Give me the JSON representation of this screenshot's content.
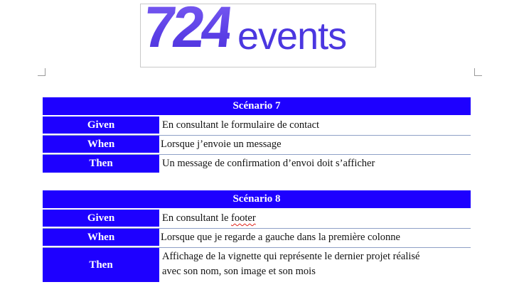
{
  "logo": {
    "number": "724",
    "word": "events"
  },
  "scenarios": [
    {
      "title": "Scénario 7",
      "rows": [
        {
          "label": "Given",
          "text": "En consultant le formulaire de contact"
        },
        {
          "label": "When",
          "text": "Lorsque j’envoie un message"
        },
        {
          "label": "Then",
          "text": "Un message de confirmation d’envoi doit s’afficher"
        }
      ]
    },
    {
      "title": "Scénario 8",
      "rows": [
        {
          "label": "Given",
          "text_before": "En consultant le ",
          "text_flagged": "footer"
        },
        {
          "label": "When",
          "text": "Lorsque que je regarde a gauche dans la première colonne"
        },
        {
          "label": "Then",
          "line1": "Affichage de la vignette qui représente le dernier projet réalisé",
          "line2": "avec son nom, son image et son mois"
        }
      ]
    }
  ]
}
